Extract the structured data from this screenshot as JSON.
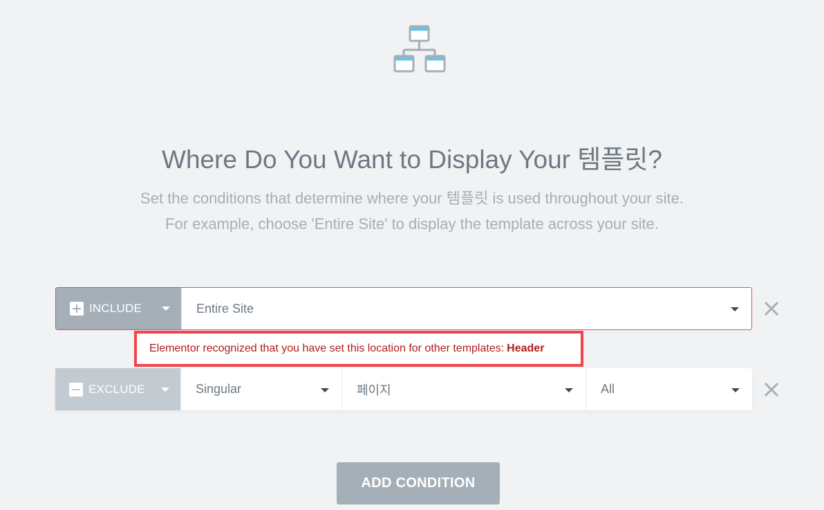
{
  "header": {
    "title": "Where Do You Want to Display Your 템플릿?",
    "subtitle_line1": "Set the conditions that determine where your 템플릿 is used throughout your site.",
    "subtitle_line2": "For example, choose 'Entire Site' to display the template across your site."
  },
  "conditions": {
    "include": {
      "type_label": "INCLUDE",
      "type_icon": "plus-icon",
      "value": "Entire Site"
    },
    "exclude": {
      "type_label": "EXCLUDE",
      "type_icon": "minus-icon",
      "value1": "Singular",
      "value2": "페이지",
      "value3": "All"
    }
  },
  "warning": {
    "message": "Elementor recognized that you have set this location for other templates:",
    "template": "Header"
  },
  "actions": {
    "add_condition_label": "ADD CONDITION"
  },
  "colors": {
    "background": "#f1f2f4",
    "accent_gray": "#a4afb7",
    "error_red": "#f2434a",
    "error_text": "#b01b1b"
  }
}
